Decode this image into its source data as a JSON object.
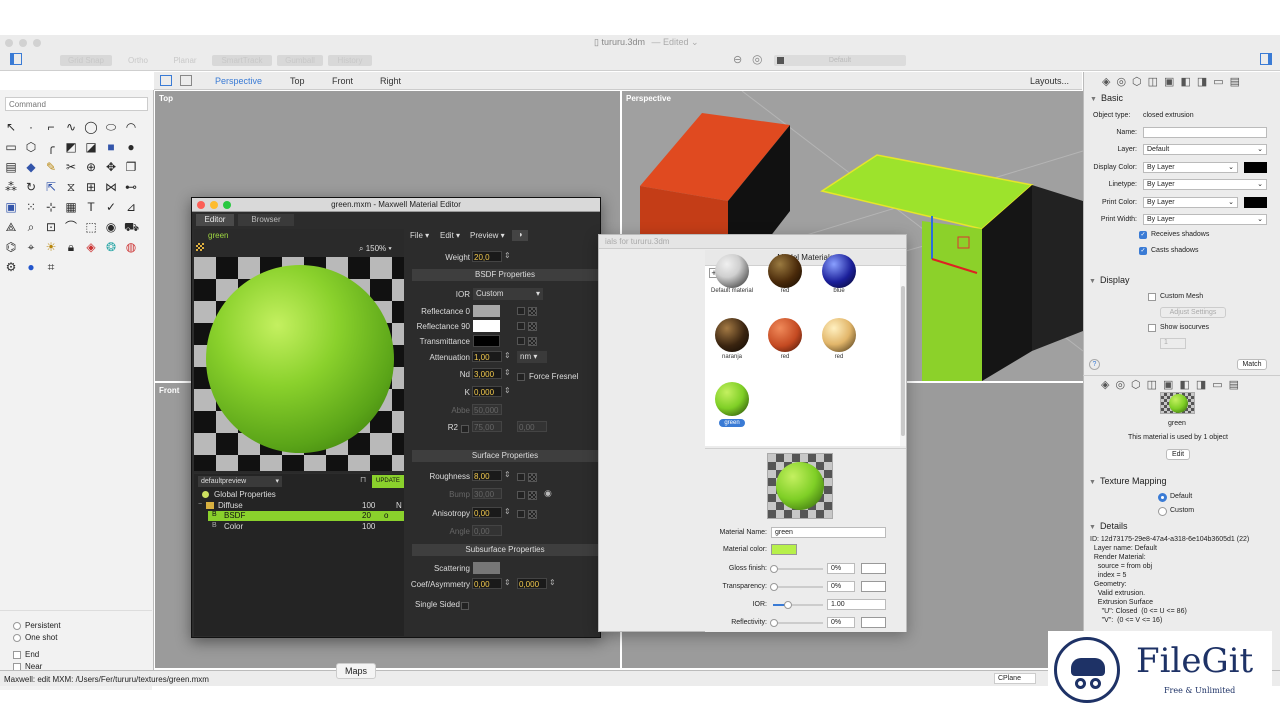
{
  "window": {
    "filename": "tururu.3dm",
    "edited": "— Edited ⌄",
    "toolbar_buttons": [
      "Grid Snap",
      "Ortho",
      "Planar",
      "SmartTrack",
      "Gumball",
      "History"
    ],
    "layer_dropdown": "Default"
  },
  "view_tabs": {
    "tabs": [
      "Perspective",
      "Top",
      "Front",
      "Right"
    ],
    "active": "Perspective",
    "layouts": "Layouts..."
  },
  "command": {
    "placeholder": "Command"
  },
  "viewports": {
    "top": "Top",
    "perspective": "Perspective",
    "front": "Front"
  },
  "osnap": {
    "persistent": "Persistent",
    "one_shot": "One shot",
    "end": "End",
    "near": "Near"
  },
  "maxwell": {
    "title": "green.mxm - Maxwell Material Editor",
    "tabs": [
      "Editor",
      "Browser"
    ],
    "material_name": "green",
    "zoom": "150%",
    "menus": [
      "File",
      "Edit",
      "Preview"
    ],
    "weight_label": "Weight",
    "weight_value": "20,0",
    "bsdf_header": "BSDF Properties",
    "ior_label": "IOR",
    "ior_value": "Custom",
    "reflectance0": "Reflectance 0",
    "reflectance90": "Reflectance 90",
    "transmittance": "Transmittance",
    "attenuation_label": "Attenuation",
    "attenuation_value": "1,00",
    "attenuation_unit": "nm",
    "nd_label": "Nd",
    "nd_value": "3,000",
    "force_fresnel": "Force Fresnel",
    "k_label": "K",
    "k_value": "0,000",
    "abbe_label": "Abbe",
    "abbe_value": "50,000",
    "r2_label": "R2",
    "r2_value1": "75,00",
    "r2_value2": "0,00",
    "surface_header": "Surface Properties",
    "roughness_label": "Roughness",
    "roughness_value": "8,00",
    "bump_label": "Bump",
    "bump_value": "30,00",
    "anisotropy_label": "Anisotropy",
    "anisotropy_value": "0,00",
    "angle_label": "Angle",
    "angle_value": "0,00",
    "subsurface_header": "Subsurface Properties",
    "scattering_label": "Scattering",
    "coef_label": "Coef/Asymmetry",
    "coef_value1": "0,00",
    "coef_value2": "0,000",
    "single_sided": "Single Sided",
    "preview_scene": "defaultpreview",
    "update": "UPDATE",
    "tree": [
      {
        "name": "Global Properties",
        "weight": "",
        "mark": ""
      },
      {
        "name": "Diffuse",
        "weight": "100",
        "mark": "N"
      },
      {
        "name": "BSDF",
        "weight": "20",
        "mark": "o"
      },
      {
        "name": "Color",
        "weight": "100",
        "mark": ""
      }
    ]
  },
  "material_lib": {
    "title_partial": "ials for tururu.3dm",
    "header": "Model Materials",
    "materials": [
      {
        "name": "Default material",
        "color": "#cfcfcf"
      },
      {
        "name": "red",
        "color": "#4a2a0a"
      },
      {
        "name": "blue",
        "color": "#1b1f9a"
      },
      {
        "name": "naranja",
        "color": "#3a2410"
      },
      {
        "name": "red",
        "color": "#c44a22"
      },
      {
        "name": "red",
        "color": "#e2b66a"
      },
      {
        "name": "green",
        "color": "#7fcf26"
      }
    ],
    "name_label": "Material Name:",
    "name_value": "green",
    "color_label": "Material color:",
    "color_value": "#b7f04a",
    "gloss_label": "Gloss finish:",
    "gloss_value": "0%",
    "transparency_label": "Transparency:",
    "transparency_value": "0%",
    "ior_label": "IOR:",
    "ior_value": "1.00",
    "reflectivity_label": "Reflectivity:",
    "reflectivity_value": "0%"
  },
  "properties": {
    "basic_header": "Basic",
    "object_type_label": "Object type:",
    "object_type_value": "closed extrusion",
    "name_label": "Name:",
    "layer_label": "Layer:",
    "layer_value": "Default",
    "display_color_label": "Display Color:",
    "display_color_value": "By Layer",
    "linetype_label": "Linetype:",
    "linetype_value": "By Layer",
    "print_color_label": "Print Color:",
    "print_color_value": "By Layer",
    "print_width_label": "Print Width:",
    "print_width_value": "By Layer",
    "receives_shadows": "Receives shadows",
    "casts_shadows": "Casts shadows",
    "display_header": "Display",
    "custom_mesh": "Custom Mesh",
    "adjust_settings": "Adjust Settings",
    "show_isocurves": "Show isocurves",
    "isocurve_count": "1",
    "help": "?",
    "match": "Match",
    "material_used_by": "This material is used by 1 object",
    "edit": "Edit",
    "texture_header": "Texture Mapping",
    "tm_default": "Default",
    "tm_custom": "Custom",
    "details_header": "Details",
    "details": [
      "ID: 12d73175-29e8-47a4-a318-6e104b3605d1 (22)",
      "  Layer name: Default",
      "  Render Material:",
      "    source = from obj",
      "    index = 5",
      "  Geometry:",
      "    Valid extrusion.",
      "    Extrusion Surface",
      "      \"U\": Closed  (0 <= U <= 86)",
      "      \"V\":  (0 <= V <= 16)"
    ]
  },
  "status": {
    "message": "Maxwell: edit MXM: /Users/Fer/tururu/textures/green.mxm",
    "maps": "Maps",
    "cplane": "CPlane"
  },
  "watermark": {
    "name": "FileGit",
    "tagline": "Free & Unlimited"
  }
}
